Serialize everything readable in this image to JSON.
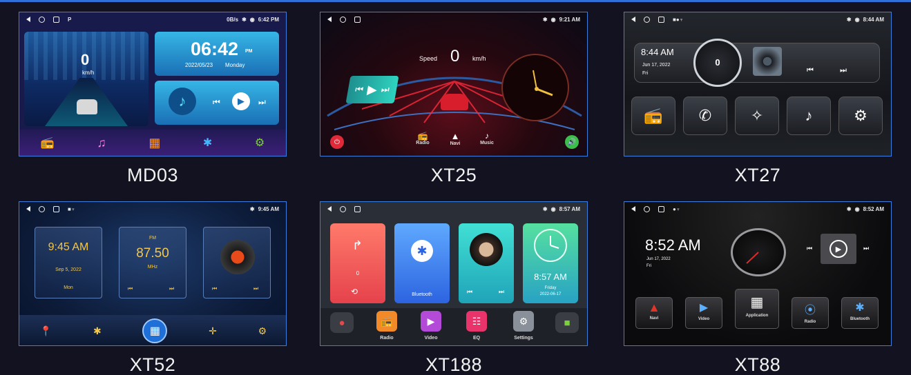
{
  "products": [
    {
      "model": "MD03",
      "status": {
        "left_extra": "P",
        "right": "0B/s",
        "time": "6:42 PM"
      },
      "speed": "0",
      "speed_unit": "km/h",
      "clock": "06:42",
      "clock_ampm": "PM",
      "date": "2022/05/23",
      "day": "Monday"
    },
    {
      "model": "XT25",
      "status": {
        "time": "9:21 AM"
      },
      "speed_label": "Speed",
      "speed": "0",
      "speed_unit": "km/h",
      "dock": [
        "Radio",
        "Navi",
        "Music"
      ]
    },
    {
      "model": "XT27",
      "status": {
        "time": "8:44 AM"
      },
      "clock": "8:44 AM",
      "date": "Jun 17, 2022",
      "day": "Fri",
      "speed": "0"
    },
    {
      "model": "XT52",
      "status": {
        "time": "9:45 AM"
      },
      "clock": "9:45 AM",
      "date": "Sep 5, 2022",
      "day": "Mon",
      "band": "FM",
      "freq": "87.50",
      "freq_unit": "MHz"
    },
    {
      "model": "XT188",
      "status": {
        "time": "8:57 AM"
      },
      "nav_dist": "0",
      "bt_label": "Bluetooth",
      "clock": "8:57 AM",
      "day": "Friday",
      "date": "2022-06-17",
      "dock": [
        "Radio",
        "Video",
        "EQ",
        "Settings"
      ]
    },
    {
      "model": "XT88",
      "status": {
        "time": "8:52 AM"
      },
      "clock": "8:52 AM",
      "date": "Jun 17, 2022",
      "day": "Fri",
      "tiles": [
        "Navi",
        "Video",
        "Application",
        "Radio",
        "Bluetooth"
      ]
    }
  ],
  "colors": {
    "frame": "#3a7fe0",
    "background": "#121220",
    "accent_red": "#e02a3a"
  }
}
